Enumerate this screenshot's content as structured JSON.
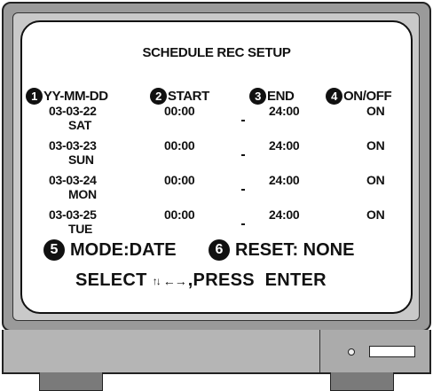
{
  "screen": {
    "title": "SCHEDULE REC SETUP",
    "headers": [
      {
        "num": "1",
        "label": "YY-MM-DD"
      },
      {
        "num": "2",
        "label": "START"
      },
      {
        "num": "3",
        "label": "END"
      },
      {
        "num": "4",
        "label": "ON/OFF"
      }
    ],
    "rows": [
      {
        "date": "03-03-22",
        "day": "SAT",
        "start": "00:00",
        "end": "24:00",
        "state": "ON"
      },
      {
        "date": "03-03-23",
        "day": "SUN",
        "start": "00:00",
        "end": "24:00",
        "state": "ON"
      },
      {
        "date": "03-03-24",
        "day": "MON",
        "start": "00:00",
        "end": "24:00",
        "state": "ON"
      },
      {
        "date": "03-03-25",
        "day": "TUE",
        "start": "00:00",
        "end": "24:00",
        "state": "ON"
      }
    ],
    "mode": {
      "num": "5",
      "label": "MODE:DATE"
    },
    "reset": {
      "num": "6",
      "label": "RESET: NONE"
    },
    "select": {
      "prefix": "SELECT",
      "arrows_ud": "↑↓",
      "arrows_lr": "←→",
      "suffix": ",PRESS  ENTER"
    }
  }
}
